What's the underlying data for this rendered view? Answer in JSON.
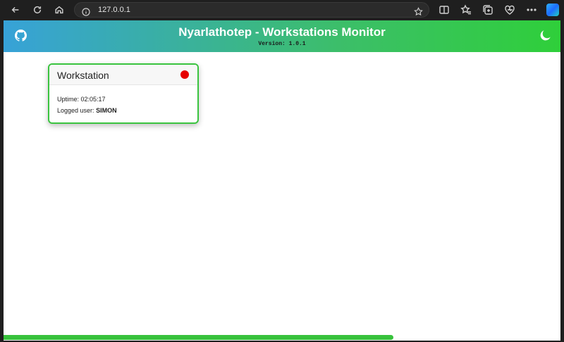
{
  "browser": {
    "url": "127.0.0.1",
    "icons": [
      "back-icon",
      "refresh-icon",
      "home-icon",
      "info-icon",
      "star-icon",
      "split-screen-icon",
      "favorites-icon",
      "collections-icon",
      "browser-essentials-icon",
      "more-icon",
      "copilot-icon"
    ]
  },
  "header": {
    "title": "Nyarlathotep - Workstations Monitor",
    "version": "Version: 1.0.1",
    "colors": {
      "gradient_start": "#37a2d8",
      "gradient_end": "#2fcf3a"
    }
  },
  "workstation": {
    "name": "Workstation",
    "status_color": "#e60000",
    "uptime_label": "Uptime:",
    "uptime": "02:05:17",
    "user_label": "Logged user:",
    "user": "SIMON",
    "border_color": "#3ac43f"
  },
  "progress": {
    "percent": 70
  }
}
